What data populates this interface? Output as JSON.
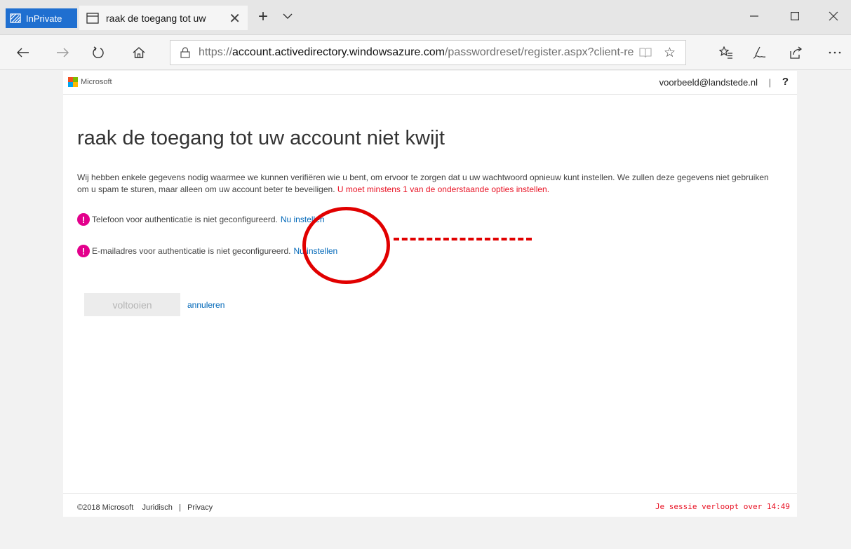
{
  "browser": {
    "inprivate_label": "InPrivate",
    "tab_title": "raak de toegang tot uw",
    "address": {
      "protocol": "https://",
      "host": "account.activedirectory.windowsazure.com",
      "path": "/passwordreset/register.aspx?client-re"
    },
    "icons": [
      "inprivate-icon",
      "tab-page-icon",
      "close-icon",
      "new-tab-icon",
      "chevron-down-icon",
      "minimize-icon",
      "maximize-icon",
      "window-close-icon",
      "back-icon",
      "forward-icon",
      "refresh-icon",
      "home-icon",
      "lock-icon",
      "reading-view-icon",
      "favorite-star-icon",
      "favorites-list-icon",
      "pen-icon",
      "share-icon",
      "more-icon"
    ]
  },
  "header": {
    "brand": "Microsoft",
    "user_email": "voorbeeld@landstede.nl",
    "separator": "|",
    "help": "?"
  },
  "main": {
    "title": "raak de toegang tot uw account niet kwijt",
    "intro_text": "Wij hebben enkele gegevens nodig waarmee we kunnen verifiëren wie u bent, om ervoor te zorgen dat u uw wachtwoord opnieuw kunt instellen. We zullen deze gegevens niet gebruiken om u spam te sturen, maar alleen om uw account beter te beveiligen.",
    "intro_required": "U moet minstens 1 van de onderstaande opties instellen.",
    "options": [
      {
        "text": "Telefoon voor authenticatie is niet geconfigureerd.",
        "link": "Nu instellen"
      },
      {
        "text": "E-mailadres voor authenticatie is niet geconfigureerd.",
        "link": "Nu instellen"
      }
    ],
    "finish_label": "voltooien",
    "cancel_label": "annuleren"
  },
  "footer": {
    "copyright": "©2018 Microsoft",
    "legal": "Juridisch",
    "divider": "|",
    "privacy": "Privacy",
    "session_notice": "Je sessie verloopt over 14:49"
  },
  "colors": {
    "accent": "#1f6fd0",
    "link": "#0067b8",
    "warning": "#e3008c",
    "error": "#e81123",
    "annotation": "#e10000"
  }
}
